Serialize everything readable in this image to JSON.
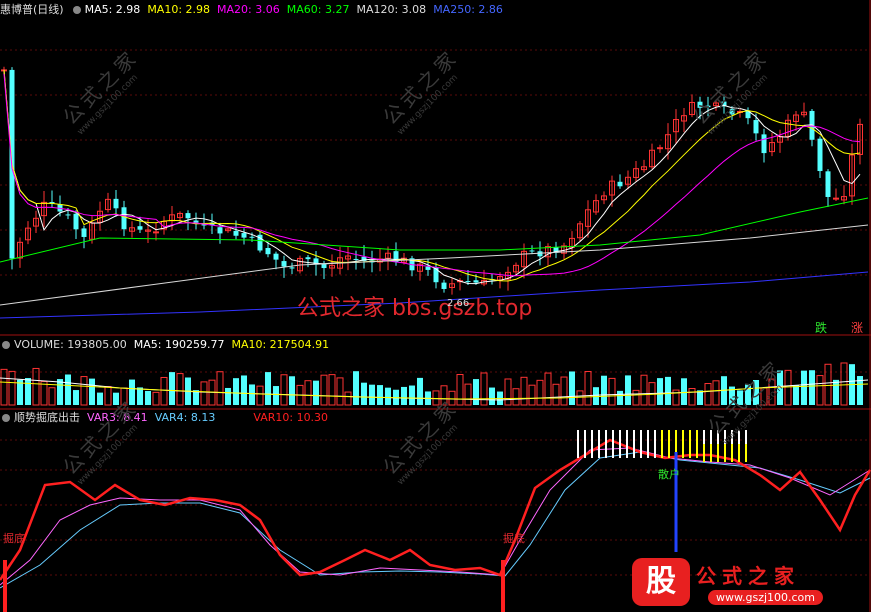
{
  "main_header": {
    "stock": "惠博普(日线)",
    "ma5": "MA5: 2.98",
    "ma10": "MA10: 2.98",
    "ma20": "MA20: 3.06",
    "ma60": "MA60: 3.27",
    "ma120": "MA120: 3.08",
    "ma250": "MA250: 2.86"
  },
  "volume_header": {
    "volume": "VOLUME: 193805.00",
    "ma5": "MA5: 190259.77",
    "ma10": "MA10: 217504.91"
  },
  "indicator_header": {
    "name": "顺势掘底出击",
    "var3": "VAR3: 8.41",
    "var4": "VAR4: 8.13",
    "var10": "VAR10: 10.30"
  },
  "labels": {
    "low_price": "2.66",
    "die": "跌",
    "zhang": "涨",
    "juedi": "掘底",
    "sans": "散户",
    "site_watermark": "公式之家 bbs.gszb.top",
    "watermark_text": "公式之家",
    "watermark_url": "www.gszj100.com",
    "logo_gu": "股",
    "logo_name": "公式之家",
    "logo_url": "www.gszj100.com"
  },
  "colors": {
    "up": "#ff3333",
    "down": "#54ffff",
    "ma5": "#ffffff",
    "ma10": "#ffff00",
    "ma20": "#ff00ff",
    "ma60": "#00ff00",
    "ma120": "#d8d8d8",
    "ma250": "#3333ff",
    "var3": "#ff66ff",
    "var4": "#66ccff",
    "var10": "#ff2020"
  }
}
